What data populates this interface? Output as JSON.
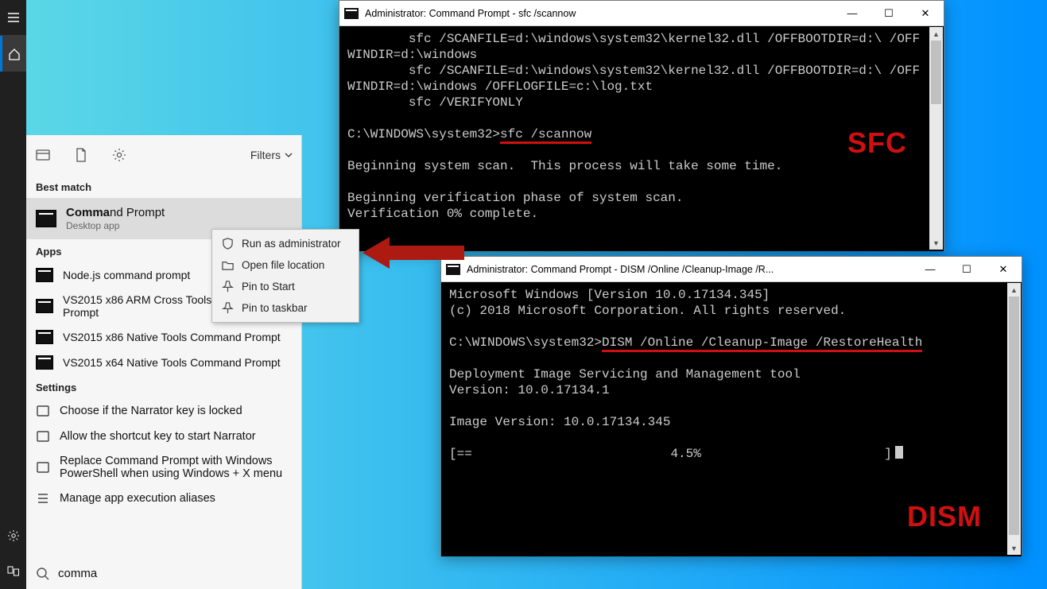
{
  "start_panel": {
    "filters_label": "Filters",
    "best_match_label": "Best match",
    "best_match_title_prefix": "Comma",
    "best_match_title_suffix": "nd Prompt",
    "best_match_sub": "Desktop app",
    "apps_label": "Apps",
    "apps": [
      "Node.js command prompt",
      "VS2015 x86 ARM Cross Tools Command Prompt",
      "VS2015 x86 Native Tools Command Prompt",
      "VS2015 x64 Native Tools Command Prompt"
    ],
    "settings_label": "Settings",
    "settings": [
      "Choose if the Narrator key is locked",
      "Allow the shortcut key to start Narrator",
      "Replace Command Prompt with Windows PowerShell when using Windows + X menu",
      "Manage app execution aliases"
    ],
    "search_value": "comma"
  },
  "context_menu": {
    "items": [
      "Run as administrator",
      "Open file location",
      "Pin to Start",
      "Pin to taskbar"
    ]
  },
  "cmd_sfc": {
    "title": "Administrator: Command Prompt - sfc  /scannow",
    "line1": "        sfc /SCANFILE=d:\\windows\\system32\\kernel32.dll /OFFBOOTDIR=d:\\ /OFF",
    "line2": "WINDIR=d:\\windows",
    "line3": "        sfc /SCANFILE=d:\\windows\\system32\\kernel32.dll /OFFBOOTDIR=d:\\ /OFF",
    "line4": "WINDIR=d:\\windows /OFFLOGFILE=c:\\log.txt",
    "line5": "        sfc /VERIFYONLY",
    "prompt": "C:\\WINDOWS\\system32>",
    "cmd_underlined": "sfc /scannow",
    "out1": "Beginning system scan.  This process will take some time.",
    "out2": "Beginning verification phase of system scan.",
    "out3": "Verification 0% complete.",
    "label": "SFC"
  },
  "cmd_dism": {
    "title": "Administrator: Command Prompt - DISM  /Online /Cleanup-Image /R...",
    "line1": "Microsoft Windows [Version 10.0.17134.345]",
    "line2": "(c) 2018 Microsoft Corporation. All rights reserved.",
    "prompt": "C:\\WINDOWS\\system32>",
    "cmd_underlined": "DISM /Online /Cleanup-Image /RestoreHealth",
    "out1": "Deployment Image Servicing and Management tool",
    "out2": "Version: 10.0.17134.1",
    "out3": "Image Version: 10.0.17134.345",
    "progress_left": "[==",
    "progress_pct": "4.5%",
    "progress_right": "]",
    "label": "DISM"
  }
}
